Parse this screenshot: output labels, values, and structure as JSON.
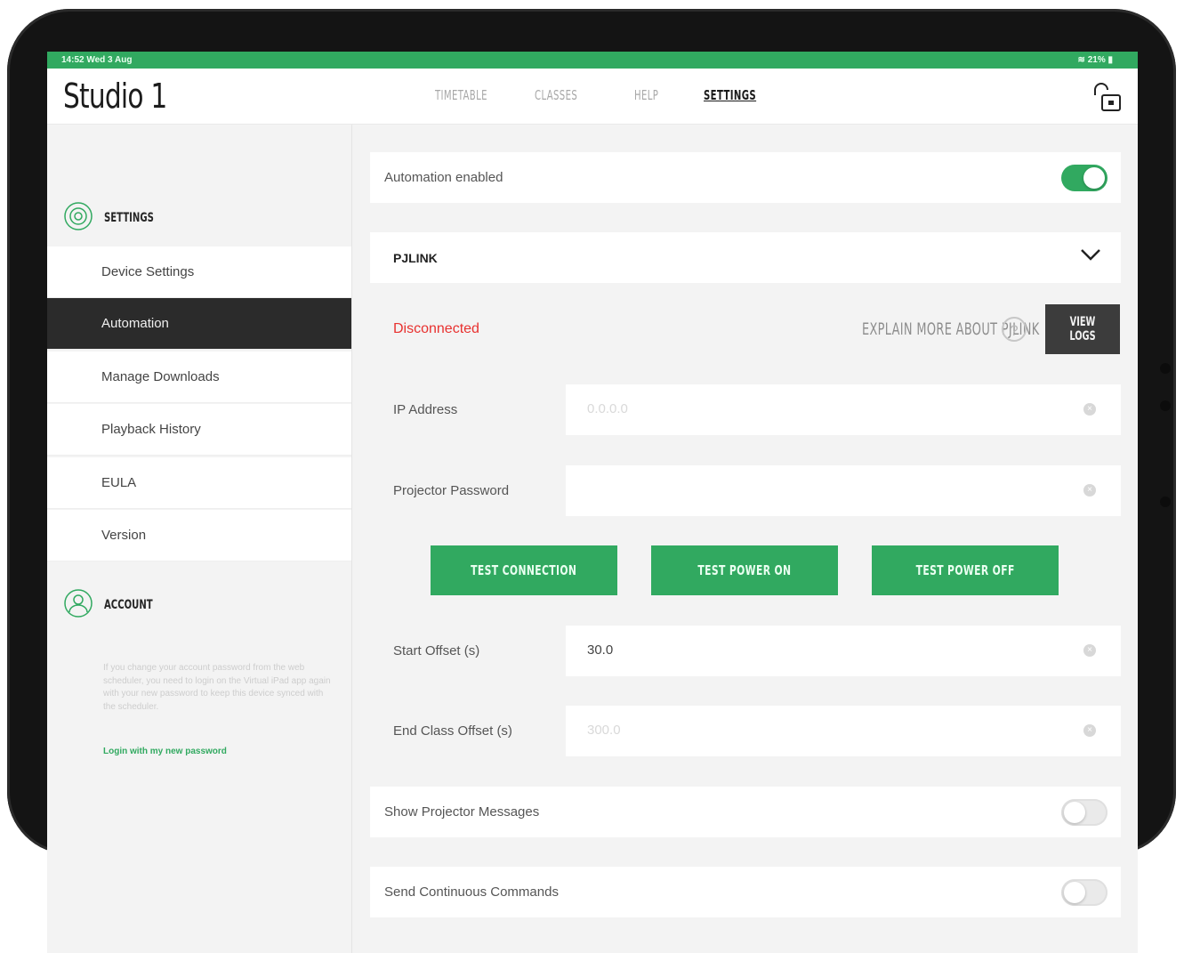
{
  "status_bar": {
    "time": "14:52  Wed 3 Aug",
    "battery": "21%"
  },
  "app": {
    "title": "Studio 1"
  },
  "nav": {
    "tabs": [
      "TIMETABLE",
      "CLASSES",
      "HELP",
      "SETTINGS"
    ],
    "active": "SETTINGS"
  },
  "sidebar": {
    "settings_header": "SETTINGS",
    "items": [
      "Device Settings",
      "Automation",
      "Manage Downloads",
      "Playback History",
      "EULA",
      "Version"
    ],
    "active_item": "Automation",
    "account_header": "ACCOUNT",
    "account_note": "If you change your account password from the web scheduler, you need to login on the Virtual iPad app again with your new password to keep this device synced with the scheduler.",
    "account_link": "Login with my new password"
  },
  "main": {
    "automation_label": "Automation enabled",
    "automation_enabled": true,
    "section_title": "PJLINK",
    "status": "Disconnected",
    "explain_label": "EXPLAIN MORE ABOUT PJLINK",
    "help_symbol": "?",
    "view_logs_label": "VIEW LOGS",
    "ip_label": "IP Address",
    "ip_placeholder": "0.0.0.0",
    "password_label": "Projector Password",
    "password_value": "",
    "buttons": [
      "TEST CONNECTION",
      "TEST POWER ON",
      "TEST POWER OFF"
    ],
    "start_offset_label": "Start Offset (s)",
    "start_offset_value": "30.0",
    "end_offset_label": "End Class Offset (s)",
    "end_offset_placeholder": "300.0",
    "show_messages_label": "Show Projector Messages",
    "show_messages_enabled": false,
    "continuous_label": "Send Continuous Commands",
    "continuous_enabled": false
  },
  "colors": {
    "accent": "#31a960",
    "error": "#e8312f",
    "dark": "#2b2b2b"
  }
}
